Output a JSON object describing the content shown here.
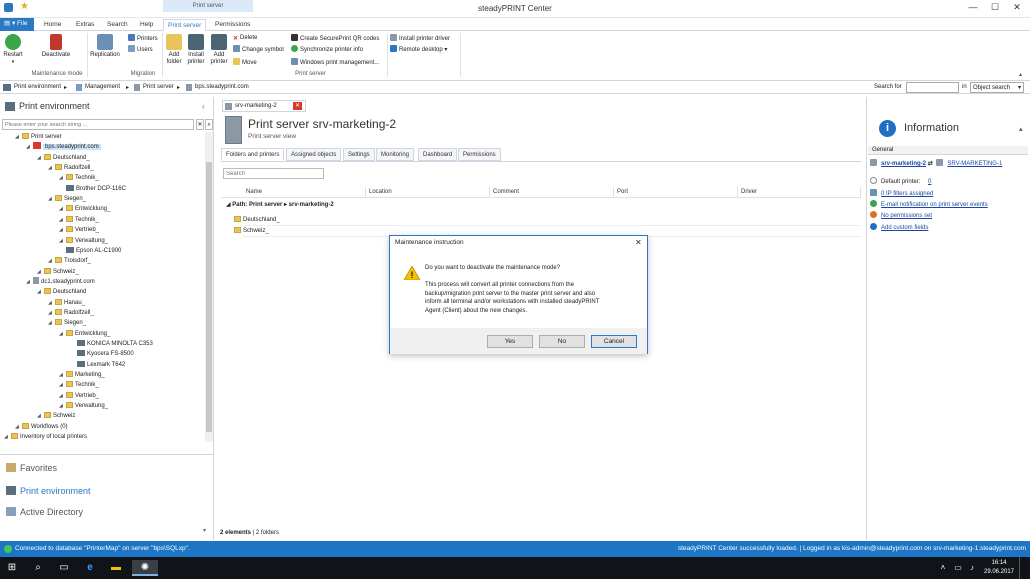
{
  "window": {
    "title": "steadyPRINT Center",
    "context_tab_group": "Print server"
  },
  "tabs": {
    "file": "File",
    "home": "Home",
    "extras": "Extras",
    "search": "Search",
    "help": "Help",
    "print_server": "Print server",
    "permissions": "Permissions"
  },
  "ribbon": {
    "restart": "Restart",
    "deactivate": "Deactivate",
    "group_maintenance": "Maintenance mode",
    "replication": "Replication",
    "printers": "Printers",
    "users": "Users",
    "group_migration": "Migration",
    "add_folder_1": "Add",
    "add_folder_2": "folder",
    "install_printer_1": "Install",
    "install_printer_2": "printer",
    "add_printer_1": "Add",
    "add_printer_2": "printer",
    "delete": "Delete",
    "change_symbol": "Change symbol",
    "move": "Move",
    "create_qr": "Create SecurePrint QR codes",
    "sync_info": "Synchronize printer info",
    "win_print_mgmt": "Windows print management...",
    "group_print_server": "Print server",
    "install_driver": "Install printer driver",
    "remote_desktop": "Remote desktop"
  },
  "address": {
    "crumbs": [
      "Print environment",
      "Management",
      "Print server",
      "bps.steadyprint.com"
    ],
    "search_label": "Search for",
    "search_value": "",
    "in_label": "in",
    "scope": "Object search"
  },
  "left": {
    "title": "Print environment",
    "search_placeholder": "Please enter your search string ...",
    "tree": [
      {
        "label": "Print server",
        "depth": 1,
        "kind": "folder"
      },
      {
        "label": "bps.steadyprint.com",
        "depth": 2,
        "kind": "server-warn"
      },
      {
        "label": "Deutschland_",
        "depth": 3,
        "kind": "folder"
      },
      {
        "label": "Radolfzell_",
        "depth": 4,
        "kind": "folder"
      },
      {
        "label": "Technik_",
        "depth": 5,
        "kind": "folder"
      },
      {
        "label": "Brother DCP-116C",
        "depth": 5,
        "kind": "printer"
      },
      {
        "label": "Siegen_",
        "depth": 4,
        "kind": "folder"
      },
      {
        "label": "Entwicklung_",
        "depth": 5,
        "kind": "folder"
      },
      {
        "label": "Technik_",
        "depth": 5,
        "kind": "folder"
      },
      {
        "label": "Vertrieb_",
        "depth": 5,
        "kind": "folder"
      },
      {
        "label": "Verwaltung_",
        "depth": 5,
        "kind": "folder"
      },
      {
        "label": "Epson AL-C1900",
        "depth": 5,
        "kind": "printer"
      },
      {
        "label": "Troisdorf_",
        "depth": 4,
        "kind": "folder"
      },
      {
        "label": "Schweiz_",
        "depth": 3,
        "kind": "folder"
      },
      {
        "label": "dc1.steadyprint.com",
        "depth": 2,
        "kind": "server"
      },
      {
        "label": "Deutschland",
        "depth": 3,
        "kind": "folder"
      },
      {
        "label": "Hanau_",
        "depth": 4,
        "kind": "folder"
      },
      {
        "label": "Radolfzell_",
        "depth": 4,
        "kind": "folder"
      },
      {
        "label": "Siegen_",
        "depth": 4,
        "kind": "folder"
      },
      {
        "label": "Entwicklung_",
        "depth": 5,
        "kind": "folder"
      },
      {
        "label": "KONICA MINOLTA C353",
        "depth": 6,
        "kind": "printer"
      },
      {
        "label": "Kyocera FS-8500",
        "depth": 6,
        "kind": "printer"
      },
      {
        "label": "Lexmark T642",
        "depth": 6,
        "kind": "printer"
      },
      {
        "label": "Marketing_",
        "depth": 5,
        "kind": "folder"
      },
      {
        "label": "Technik_",
        "depth": 5,
        "kind": "folder"
      },
      {
        "label": "Vertrieb_",
        "depth": 5,
        "kind": "folder"
      },
      {
        "label": "Verwaltung_",
        "depth": 5,
        "kind": "folder"
      },
      {
        "label": "Schweiz",
        "depth": 3,
        "kind": "folder"
      },
      {
        "label": "Workflows (0)",
        "depth": 1,
        "kind": "folder"
      },
      {
        "label": "Inventory of local printers",
        "depth": 0,
        "kind": "folder"
      }
    ],
    "nav": [
      "Favorites",
      "Print environment",
      "Active Directory"
    ]
  },
  "center": {
    "doc_tab": "srv-marketing-2",
    "title": "Print server srv-marketing-2",
    "subtitle": "Print server view",
    "tabs": [
      "Folders and printers",
      "Assigned objects",
      "Settings",
      "Monitoring",
      "Dashboard",
      "Permissions"
    ],
    "search_placeholder": "Search",
    "columns": [
      "Name",
      "Location",
      "Comment",
      "Port",
      "Driver"
    ],
    "path_label": "Path:",
    "path_value": "Print server ▸ srv-marketing-2",
    "rows": [
      "Deutschland_",
      "Schweiz_"
    ],
    "footer_count": "2 elements",
    "footer_detail": "| 2 folders"
  },
  "info": {
    "title": "Information",
    "section": "General",
    "server_link": "srv-marketing-2",
    "server_link2": "SRV-MARKETING-1",
    "default_printer_label": "Default printer:",
    "default_printer_value": "0",
    "ip_filters": "0 IP filters assigned",
    "email_notif": "E-mail notification on print server events",
    "no_permissions": "No permissions set",
    "add_custom": "Add custom fields"
  },
  "dialog": {
    "title": "Maintenance instruction",
    "question": "Do you want to deactivate the maintenance mode?",
    "body": "This process will convert all printer connections from the backup/migration print server to the master print server and also inform all terminal and/or workstations with installed steadyPRINT Agent (Client) about the new changes.",
    "yes": "Yes",
    "no": "No",
    "cancel": "Cancel"
  },
  "status": {
    "left": "Connected to database \"PrinterMap\" on server \"bps\\SQLxp\".",
    "right": "steadyPRINT Center successfully loaded. | Logged in as kis-admin@steadyprint.com on srv-marketing-1.steadyprint.com"
  },
  "taskbar": {
    "time": "16:14",
    "date": "29.06.2017"
  },
  "colors": {
    "accent": "#2b78c5",
    "status": "#1c76c5",
    "taskbar": "#101418"
  }
}
